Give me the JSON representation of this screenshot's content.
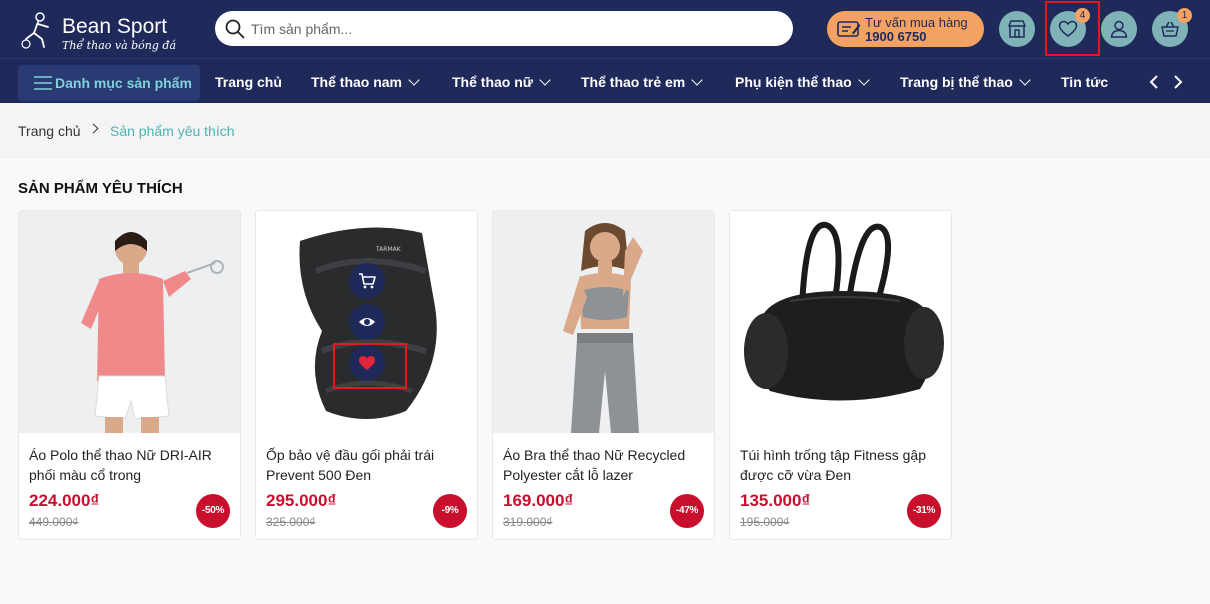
{
  "header": {
    "logo_name": "Bean Sport",
    "logo_tagline": "Thể thao và bóng đá",
    "search_placeholder": "Tìm sản phẩm...",
    "consult_label": "Tư vấn mua hàng",
    "consult_phone": "1900 6750",
    "wishlist_count": "4",
    "cart_count": "1"
  },
  "nav": {
    "category_label": "Danh mục sản phẩm",
    "items": [
      "Trang chủ",
      "Thể thao nam",
      "Thể thao nữ",
      "Thể thao trẻ em",
      "Phụ kiện thể thao",
      "Trang bị thể thao",
      "Tin tức"
    ]
  },
  "breadcrumb": {
    "home": "Trang chủ",
    "current": "Sản phẩm yêu thích"
  },
  "section_title": "SẢN PHẨM YÊU THÍCH",
  "products": [
    {
      "name": "Áo Polo thể thao Nữ DRI-AIR phối màu cổ trong",
      "price": "224.000₫",
      "old_price": "449.000₫",
      "discount": "-50%"
    },
    {
      "name": "Ốp bảo vệ đầu gối phải trái Prevent 500 Đen",
      "price": "295.000₫",
      "old_price": "325.000₫",
      "discount": "-9%"
    },
    {
      "name": "Áo Bra thể thao Nữ Recycled Polyester cắt lỗ lazer",
      "price": "169.000₫",
      "old_price": "319.000₫",
      "discount": "-47%"
    },
    {
      "name": "Túi hình trống tập Fitness gập được cỡ vừa Đen",
      "price": "135.000₫",
      "old_price": "195.000₫",
      "discount": "-31%"
    }
  ],
  "colors": {
    "header_bg": "#1f2a5b",
    "accent_teal": "#7fb3b8",
    "accent_orange": "#f4a261",
    "price_red": "#c8102e"
  }
}
